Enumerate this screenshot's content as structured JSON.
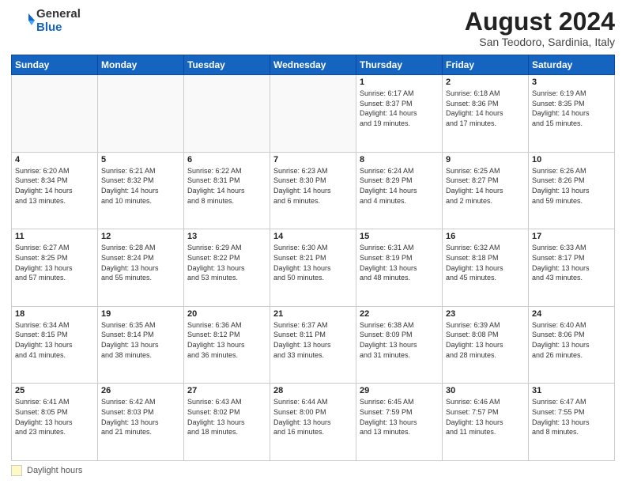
{
  "logo": {
    "general": "General",
    "blue": "Blue"
  },
  "title": "August 2024",
  "location": "San Teodoro, Sardinia, Italy",
  "days_header": [
    "Sunday",
    "Monday",
    "Tuesday",
    "Wednesday",
    "Thursday",
    "Friday",
    "Saturday"
  ],
  "footer_label": "Daylight hours",
  "weeks": [
    [
      {
        "num": "",
        "info": ""
      },
      {
        "num": "",
        "info": ""
      },
      {
        "num": "",
        "info": ""
      },
      {
        "num": "",
        "info": ""
      },
      {
        "num": "1",
        "info": "Sunrise: 6:17 AM\nSunset: 8:37 PM\nDaylight: 14 hours\nand 19 minutes."
      },
      {
        "num": "2",
        "info": "Sunrise: 6:18 AM\nSunset: 8:36 PM\nDaylight: 14 hours\nand 17 minutes."
      },
      {
        "num": "3",
        "info": "Sunrise: 6:19 AM\nSunset: 8:35 PM\nDaylight: 14 hours\nand 15 minutes."
      }
    ],
    [
      {
        "num": "4",
        "info": "Sunrise: 6:20 AM\nSunset: 8:34 PM\nDaylight: 14 hours\nand 13 minutes."
      },
      {
        "num": "5",
        "info": "Sunrise: 6:21 AM\nSunset: 8:32 PM\nDaylight: 14 hours\nand 10 minutes."
      },
      {
        "num": "6",
        "info": "Sunrise: 6:22 AM\nSunset: 8:31 PM\nDaylight: 14 hours\nand 8 minutes."
      },
      {
        "num": "7",
        "info": "Sunrise: 6:23 AM\nSunset: 8:30 PM\nDaylight: 14 hours\nand 6 minutes."
      },
      {
        "num": "8",
        "info": "Sunrise: 6:24 AM\nSunset: 8:29 PM\nDaylight: 14 hours\nand 4 minutes."
      },
      {
        "num": "9",
        "info": "Sunrise: 6:25 AM\nSunset: 8:27 PM\nDaylight: 14 hours\nand 2 minutes."
      },
      {
        "num": "10",
        "info": "Sunrise: 6:26 AM\nSunset: 8:26 PM\nDaylight: 13 hours\nand 59 minutes."
      }
    ],
    [
      {
        "num": "11",
        "info": "Sunrise: 6:27 AM\nSunset: 8:25 PM\nDaylight: 13 hours\nand 57 minutes."
      },
      {
        "num": "12",
        "info": "Sunrise: 6:28 AM\nSunset: 8:24 PM\nDaylight: 13 hours\nand 55 minutes."
      },
      {
        "num": "13",
        "info": "Sunrise: 6:29 AM\nSunset: 8:22 PM\nDaylight: 13 hours\nand 53 minutes."
      },
      {
        "num": "14",
        "info": "Sunrise: 6:30 AM\nSunset: 8:21 PM\nDaylight: 13 hours\nand 50 minutes."
      },
      {
        "num": "15",
        "info": "Sunrise: 6:31 AM\nSunset: 8:19 PM\nDaylight: 13 hours\nand 48 minutes."
      },
      {
        "num": "16",
        "info": "Sunrise: 6:32 AM\nSunset: 8:18 PM\nDaylight: 13 hours\nand 45 minutes."
      },
      {
        "num": "17",
        "info": "Sunrise: 6:33 AM\nSunset: 8:17 PM\nDaylight: 13 hours\nand 43 minutes."
      }
    ],
    [
      {
        "num": "18",
        "info": "Sunrise: 6:34 AM\nSunset: 8:15 PM\nDaylight: 13 hours\nand 41 minutes."
      },
      {
        "num": "19",
        "info": "Sunrise: 6:35 AM\nSunset: 8:14 PM\nDaylight: 13 hours\nand 38 minutes."
      },
      {
        "num": "20",
        "info": "Sunrise: 6:36 AM\nSunset: 8:12 PM\nDaylight: 13 hours\nand 36 minutes."
      },
      {
        "num": "21",
        "info": "Sunrise: 6:37 AM\nSunset: 8:11 PM\nDaylight: 13 hours\nand 33 minutes."
      },
      {
        "num": "22",
        "info": "Sunrise: 6:38 AM\nSunset: 8:09 PM\nDaylight: 13 hours\nand 31 minutes."
      },
      {
        "num": "23",
        "info": "Sunrise: 6:39 AM\nSunset: 8:08 PM\nDaylight: 13 hours\nand 28 minutes."
      },
      {
        "num": "24",
        "info": "Sunrise: 6:40 AM\nSunset: 8:06 PM\nDaylight: 13 hours\nand 26 minutes."
      }
    ],
    [
      {
        "num": "25",
        "info": "Sunrise: 6:41 AM\nSunset: 8:05 PM\nDaylight: 13 hours\nand 23 minutes."
      },
      {
        "num": "26",
        "info": "Sunrise: 6:42 AM\nSunset: 8:03 PM\nDaylight: 13 hours\nand 21 minutes."
      },
      {
        "num": "27",
        "info": "Sunrise: 6:43 AM\nSunset: 8:02 PM\nDaylight: 13 hours\nand 18 minutes."
      },
      {
        "num": "28",
        "info": "Sunrise: 6:44 AM\nSunset: 8:00 PM\nDaylight: 13 hours\nand 16 minutes."
      },
      {
        "num": "29",
        "info": "Sunrise: 6:45 AM\nSunset: 7:59 PM\nDaylight: 13 hours\nand 13 minutes."
      },
      {
        "num": "30",
        "info": "Sunrise: 6:46 AM\nSunset: 7:57 PM\nDaylight: 13 hours\nand 11 minutes."
      },
      {
        "num": "31",
        "info": "Sunrise: 6:47 AM\nSunset: 7:55 PM\nDaylight: 13 hours\nand 8 minutes."
      }
    ]
  ]
}
